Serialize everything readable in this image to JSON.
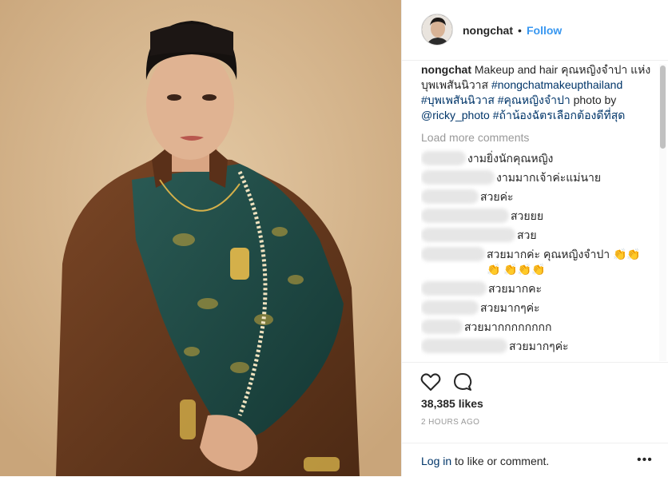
{
  "post": {
    "username": "nongchat",
    "separator": "•",
    "follow_label": "Follow",
    "caption_user": "nongchat",
    "caption_text": " Makeup and hair คุณหญิงจำปา แห่ง บุพเพสันนิวาส ",
    "caption_tags": "#nongchatmakeupthailand #บุพเพสันนิวาส #คุณหญิงจำปา",
    "caption_photo_by": " photo by ",
    "caption_mention": "@ricky_photo",
    "caption_tail": " #ถ้าน้องฉัตรเลือกต้องดีที่สุด",
    "load_more": "Load more comments",
    "comments": [
      {
        "text": "งามยิ่งนักคุณหญิง",
        "blur": 56
      },
      {
        "text": "งามมากเจ้าค่ะแม่นาย",
        "blur": 92
      },
      {
        "text": "สวยค่ะ",
        "blur": 72
      },
      {
        "text": "สวยยย",
        "blur": 110
      },
      {
        "text": "สวย",
        "blur": 120
      },
      {
        "text": "สวยมากค่ะ คุณหญิงจำปา 👏👏👏 👏👏👏",
        "blur": 82
      },
      {
        "text": "สวยมากคะ",
        "blur": 82
      },
      {
        "text": "สวยมากๆค่ะ",
        "blur": 72
      },
      {
        "text": "สวยมากกกกกกกก",
        "blur": 52
      },
      {
        "text": "สวยมากๆค่ะ",
        "blur": 110
      }
    ],
    "likes": "38,385 likes",
    "time": "2 HOURS AGO",
    "login_link": "Log in",
    "login_rest": " to like or comment.",
    "more_label": "•••"
  },
  "icons": {
    "like": "heart-icon",
    "comment": "comment-icon"
  },
  "colors": {
    "link": "#3897f0",
    "hashtag": "#003569",
    "muted": "#999999",
    "text": "#262626",
    "photo_background": "#d6b790",
    "dress_brown": "#6b3c1f",
    "sash_green": "#1e4a45"
  }
}
